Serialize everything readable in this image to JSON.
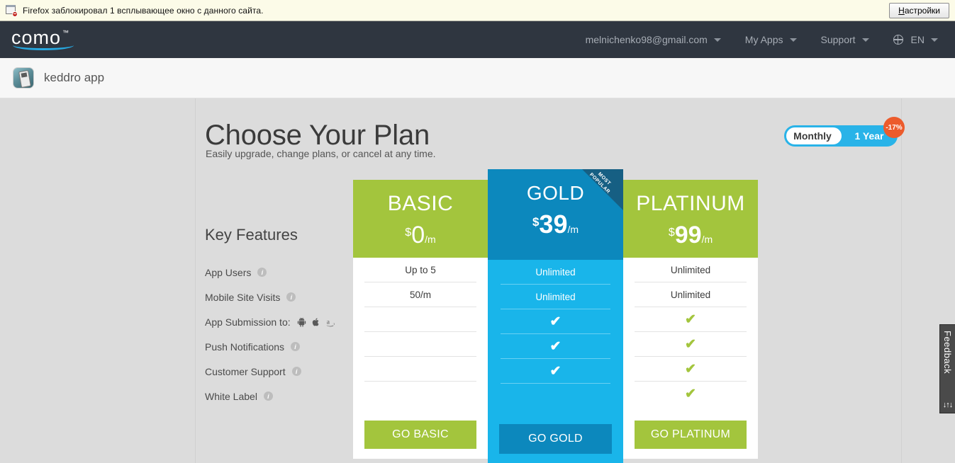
{
  "notification": {
    "icon": "popup-blocked-icon",
    "message": "Firefox заблокировал 1 всплывающее окно с данного сайта.",
    "button_label": "астройки",
    "button_accesskey": "Н"
  },
  "topnav": {
    "logo_text": "como",
    "logo_tm": "™",
    "items": [
      {
        "label": "melnichenko98@gmail.com",
        "icon": "chevron-down-icon"
      },
      {
        "label": "My Apps",
        "icon": "chevron-down-icon"
      },
      {
        "label": "Support",
        "icon": "chevron-down-icon"
      },
      {
        "label": "EN",
        "icon": "globe-icon"
      }
    ]
  },
  "app_header": {
    "app_name": "keddro app",
    "icon": "app-thumbnail-icon"
  },
  "main": {
    "title": "Choose Your Plan",
    "subtitle": "Easily upgrade, change plans, or cancel at any time.",
    "billing_toggle": {
      "monthly_label": "Monthly",
      "yearly_label": "1 Year",
      "selected": "Monthly",
      "discount_badge": "-17%",
      "accent_color": "#29b3e8",
      "badge_color": "#ec5b2c"
    },
    "features_title": "Key Features",
    "features": [
      {
        "label": "App Users",
        "info": "i"
      },
      {
        "label": "Mobile Site Visits",
        "info": "i"
      },
      {
        "label": "App Submission to:",
        "info": null,
        "stores": [
          "android-icon",
          "apple-icon",
          "amazon-icon"
        ]
      },
      {
        "label": "Push Notifications",
        "info": "i"
      },
      {
        "label": "Customer Support",
        "info": "i"
      },
      {
        "label": "White Label",
        "info": "i"
      }
    ],
    "plans": [
      {
        "name": "BASIC",
        "currency": "$",
        "amount": "0",
        "period": "/m",
        "cta": "GO BASIC",
        "header_color": "#a3c53d",
        "cells": [
          "Up to 5",
          "50/m",
          "",
          "",
          "",
          ""
        ]
      },
      {
        "name": "GOLD",
        "currency": "$",
        "amount": "39",
        "period": "/m",
        "cta": "GO GOLD",
        "header_color": "#0c88bd",
        "body_color": "#19b5ea",
        "ribbon": "MOST POPULAR",
        "cells": [
          "Unlimited",
          "Unlimited",
          "✔",
          "✔",
          "✔",
          ""
        ]
      },
      {
        "name": "PLATINUM",
        "currency": "$",
        "amount": "99",
        "period": "/m",
        "cta": "GO PLATINUM",
        "header_color": "#a3c53d",
        "cells": [
          "Unlimited",
          "Unlimited",
          "✔",
          "✔",
          "✔",
          "✔"
        ]
      }
    ]
  },
  "feedback": {
    "label": "Feedback",
    "arrows": "↓↑↓"
  }
}
